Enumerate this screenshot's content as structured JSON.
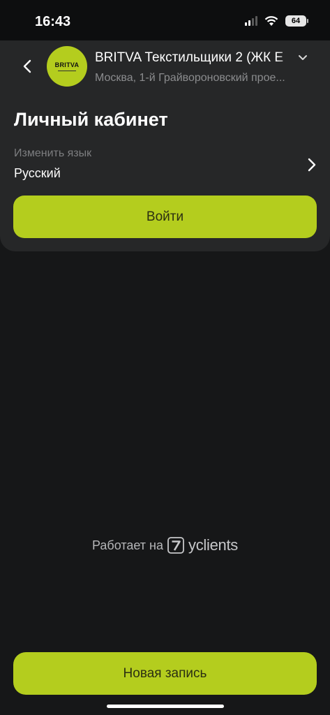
{
  "status_bar": {
    "time": "16:43",
    "battery": "64"
  },
  "header": {
    "logo_text": "BRITVA",
    "salon_name": "BRITVA Текстильщики 2 (ЖК Е",
    "address": "Москва, 1-й Грайвороновский прое..."
  },
  "page": {
    "title": "Личный кабинет"
  },
  "language": {
    "label": "Изменить язык",
    "value": "Русский"
  },
  "buttons": {
    "login": "Войти",
    "new_booking": "Новая запись"
  },
  "footer": {
    "powered_by": "Работает на",
    "brand": "yclients"
  },
  "colors": {
    "accent": "#b4cd1e",
    "background": "#161718",
    "card": "#262728"
  }
}
